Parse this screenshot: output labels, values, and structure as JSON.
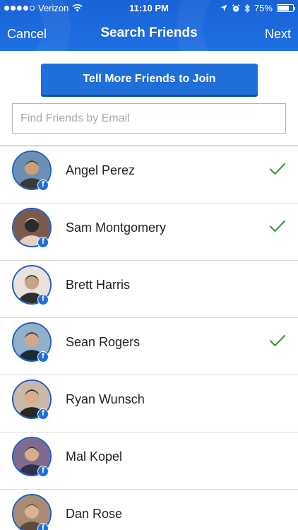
{
  "status": {
    "carrier": "Verizon",
    "time": "11:10 PM",
    "battery": "75%",
    "battery_level": 0.75
  },
  "nav": {
    "cancel": "Cancel",
    "title": "Search Friends",
    "next": "Next"
  },
  "invite_button": "Tell More Friends to Join",
  "search": {
    "placeholder": "Find Friends by Email",
    "value": ""
  },
  "friends": [
    {
      "name": "Angel Perez",
      "selected": true
    },
    {
      "name": "Sam Montgomery",
      "selected": true
    },
    {
      "name": "Brett Harris",
      "selected": false
    },
    {
      "name": "Sean Rogers",
      "selected": true
    },
    {
      "name": "Ryan Wunsch",
      "selected": false
    },
    {
      "name": "Mal Kopel",
      "selected": false
    },
    {
      "name": "Dan Rose",
      "selected": false
    }
  ],
  "colors": {
    "header": "#1f6fe3",
    "accent": "#1f6fdb",
    "check": "#3a9a3a"
  }
}
